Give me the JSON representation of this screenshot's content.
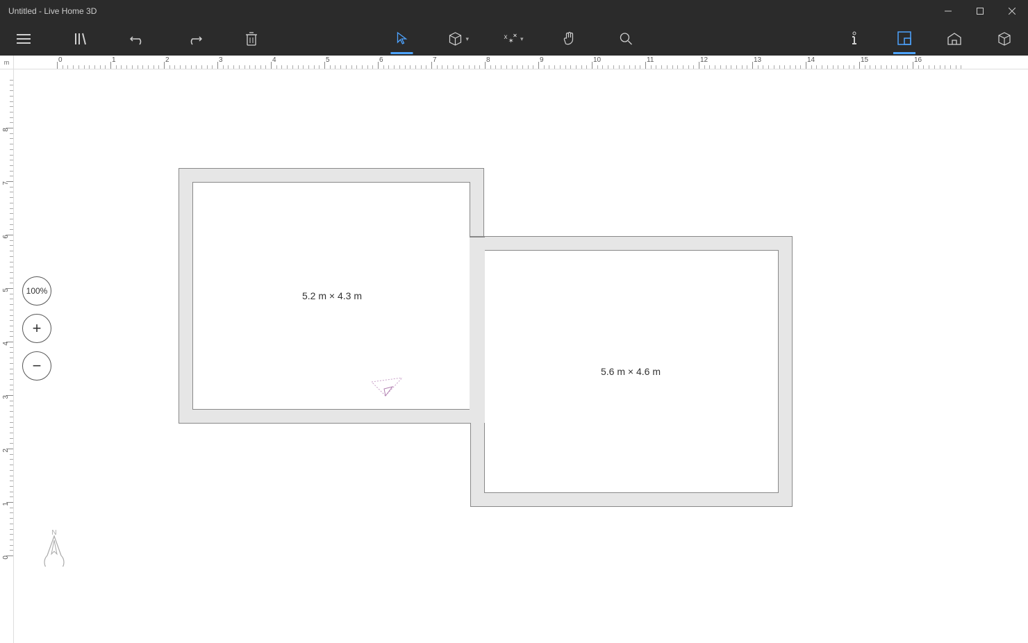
{
  "window": {
    "title": "Untitled - Live Home 3D"
  },
  "titlebar_controls": {
    "minimize": "minimize",
    "maximize": "maximize",
    "close": "close"
  },
  "toolbar": {
    "menu": "menu",
    "library": "library",
    "undo": "undo",
    "redo": "redo",
    "delete": "delete",
    "select": "select",
    "shapes": "shapes",
    "dimensions": "dimensions",
    "pan": "pan",
    "search": "search",
    "info": "info",
    "view2d": "2d view",
    "view_elevation": "elevation",
    "view3d": "3d view"
  },
  "ruler": {
    "unit": "m",
    "h_labels": [
      0,
      1,
      2,
      3,
      4,
      5,
      6,
      7,
      8,
      9,
      10,
      11,
      12,
      13,
      14,
      15,
      16
    ],
    "v_labels": [
      0,
      1,
      2,
      3,
      4,
      5,
      6,
      7,
      8
    ]
  },
  "zoom": {
    "level": "100%",
    "in": "+",
    "out": "−"
  },
  "rooms": {
    "room1_label": "5.2 m × 4.3 m",
    "room2_label": "5.6 m × 4.6 m"
  },
  "compass": {
    "north": "N"
  }
}
